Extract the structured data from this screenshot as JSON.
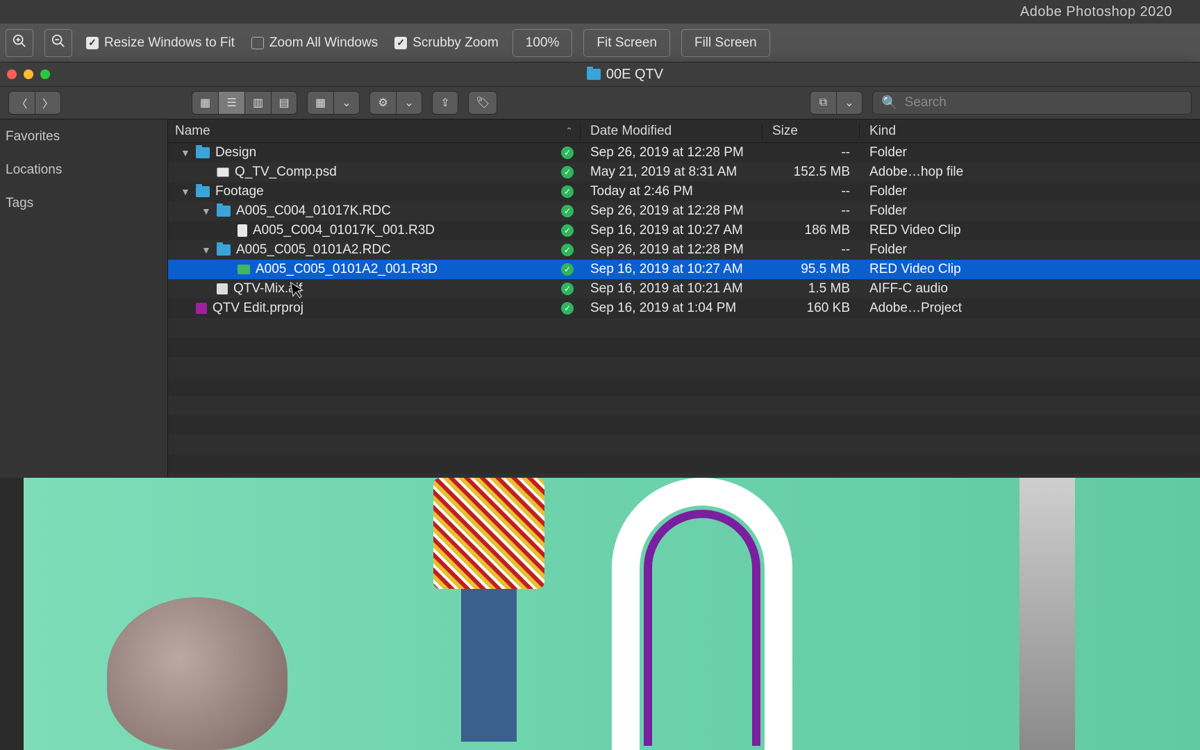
{
  "photoshop": {
    "app_title": "Adobe Photoshop 2020",
    "toolbar": {
      "resize_windows": "Resize Windows to Fit",
      "resize_checked": true,
      "zoom_all": "Zoom All Windows",
      "zoom_all_checked": false,
      "scrubby": "Scrubby Zoom",
      "scrubby_checked": true,
      "zoom_value": "100%",
      "fit_screen": "Fit Screen",
      "fill_screen": "Fill Screen"
    }
  },
  "finder": {
    "title": "00E QTV",
    "search_placeholder": "Search",
    "sidebar": {
      "items": [
        "Favorites",
        "Locations",
        "Tags"
      ]
    },
    "columns": {
      "name": "Name",
      "date": "Date Modified",
      "size": "Size",
      "kind": "Kind"
    },
    "rows": [
      {
        "indent": 0,
        "disclosure": "▼",
        "icon": "folder",
        "name": "Design",
        "date": "Sep 26, 2019 at 12:28 PM",
        "size": "--",
        "kind": "Folder",
        "selected": false
      },
      {
        "indent": 1,
        "disclosure": "",
        "icon": "psd",
        "name": "Q_TV_Comp.psd",
        "date": "May 21, 2019 at 8:31 AM",
        "size": "152.5 MB",
        "kind": "Adobe…hop file",
        "selected": false
      },
      {
        "indent": 0,
        "disclosure": "▼",
        "icon": "folder",
        "name": "Footage",
        "date": "Today at 2:46 PM",
        "size": "--",
        "kind": "Folder",
        "selected": false
      },
      {
        "indent": 1,
        "disclosure": "▼",
        "icon": "folder",
        "name": "A005_C004_01017K.RDC",
        "date": "Sep 26, 2019 at 12:28 PM",
        "size": "--",
        "kind": "Folder",
        "selected": false
      },
      {
        "indent": 2,
        "disclosure": "",
        "icon": "file",
        "name": "A005_C004_01017K_001.R3D",
        "date": "Sep 16, 2019 at 10:27 AM",
        "size": "186 MB",
        "kind": "RED Video Clip",
        "selected": false
      },
      {
        "indent": 1,
        "disclosure": "▼",
        "icon": "folder",
        "name": "A005_C005_0101A2.RDC",
        "date": "Sep 26, 2019 at 12:28 PM",
        "size": "--",
        "kind": "Folder",
        "selected": false
      },
      {
        "indent": 2,
        "disclosure": "",
        "icon": "green",
        "name": "A005_C005_0101A2_001.R3D",
        "date": "Sep 16, 2019 at 10:27 AM",
        "size": "95.5 MB",
        "kind": "RED Video Clip",
        "selected": true
      },
      {
        "indent": 1,
        "disclosure": "",
        "icon": "audio",
        "name": "QTV-Mix.aif",
        "date": "Sep 16, 2019 at 10:21 AM",
        "size": "1.5 MB",
        "kind": "AIFF-C audio",
        "selected": false
      },
      {
        "indent": 0,
        "disclosure": "",
        "icon": "pr",
        "name": "QTV Edit.prproj",
        "date": "Sep 16, 2019 at 1:04 PM",
        "size": "160 KB",
        "kind": "Adobe…Project",
        "selected": false
      }
    ]
  }
}
